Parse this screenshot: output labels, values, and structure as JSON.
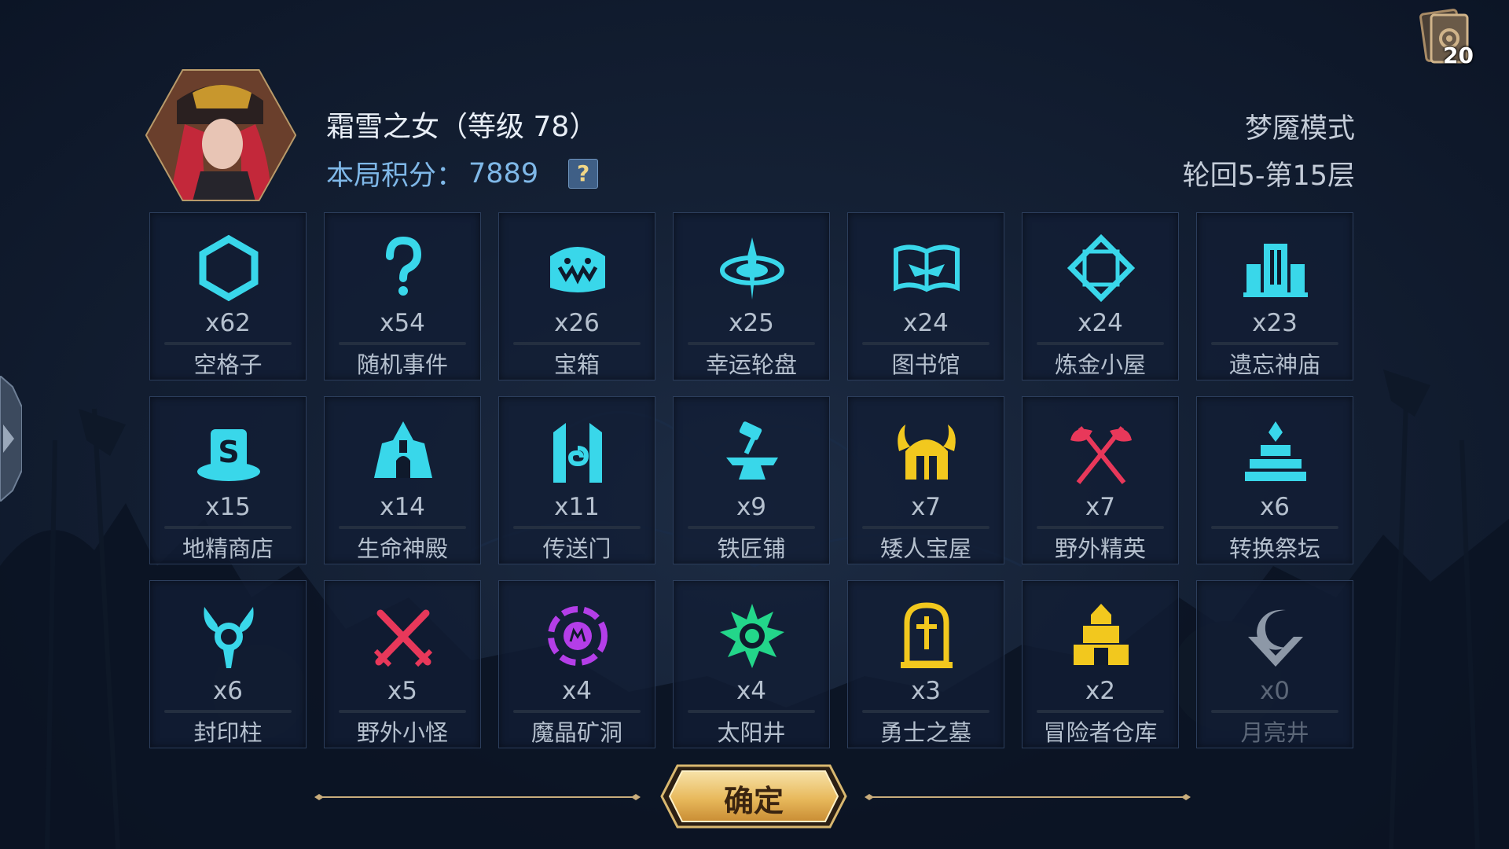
{
  "player": {
    "name": "霜雪之女（等级 78）",
    "score_label": "本局积分：",
    "score": "7889",
    "help": "?"
  },
  "mode": {
    "name": "梦魇模式",
    "floor": "轮回5-第15层"
  },
  "deck": {
    "count": "20"
  },
  "tiles": [
    {
      "icon": "hexagon-icon",
      "count": "x62",
      "label": "空格子",
      "color": "#39d7ea"
    },
    {
      "icon": "question-mark-icon",
      "count": "x54",
      "label": "随机事件",
      "color": "#39d7ea"
    },
    {
      "icon": "treasure-chest-icon",
      "count": "x26",
      "label": "宝箱",
      "color": "#39d7ea"
    },
    {
      "icon": "lucky-wheel-icon",
      "count": "x25",
      "label": "幸运轮盘",
      "color": "#39d7ea"
    },
    {
      "icon": "open-book-icon",
      "count": "x24",
      "label": "图书馆",
      "color": "#39d7ea"
    },
    {
      "icon": "alchemy-diamond-icon",
      "count": "x24",
      "label": "炼金小屋",
      "color": "#39d7ea"
    },
    {
      "icon": "temple-icon",
      "count": "x23",
      "label": "遗忘神庙",
      "color": "#39d7ea"
    },
    {
      "icon": "goblin-shop-hat-icon",
      "count": "x15",
      "label": "地精商店",
      "color": "#39d7ea"
    },
    {
      "icon": "life-shrine-icon",
      "count": "x14",
      "label": "生命神殿",
      "color": "#39d7ea"
    },
    {
      "icon": "portal-icon",
      "count": "x11",
      "label": "传送门",
      "color": "#39d7ea"
    },
    {
      "icon": "anvil-hammer-icon",
      "count": "x9",
      "label": "铁匠铺",
      "color": "#39d7ea"
    },
    {
      "icon": "dwarf-helmet-icon",
      "count": "x7",
      "label": "矮人宝屋",
      "color": "#f2c81e"
    },
    {
      "icon": "crossed-axes-icon",
      "count": "x7",
      "label": "野外精英",
      "color": "#e8385a"
    },
    {
      "icon": "altar-icon",
      "count": "x6",
      "label": "转换祭坛",
      "color": "#39d7ea"
    },
    {
      "icon": "seal-pillar-icon",
      "count": "x6",
      "label": "封印柱",
      "color": "#39d7ea"
    },
    {
      "icon": "crossed-swords-icon",
      "count": "x5",
      "label": "野外小怪",
      "color": "#e8385a"
    },
    {
      "icon": "magic-crystal-icon",
      "count": "x4",
      "label": "魔晶矿洞",
      "color": "#b43ee8"
    },
    {
      "icon": "sun-well-icon",
      "count": "x4",
      "label": "太阳井",
      "color": "#23d68a"
    },
    {
      "icon": "tombstone-icon",
      "count": "x3",
      "label": "勇士之墓",
      "color": "#f2c81e"
    },
    {
      "icon": "warehouse-icon",
      "count": "x2",
      "label": "冒险者仓库",
      "color": "#f2c81e"
    },
    {
      "icon": "moon-well-icon",
      "count": "x0",
      "label": "月亮井",
      "color": "#b7c2cf"
    }
  ],
  "confirm": {
    "label": "确定"
  }
}
